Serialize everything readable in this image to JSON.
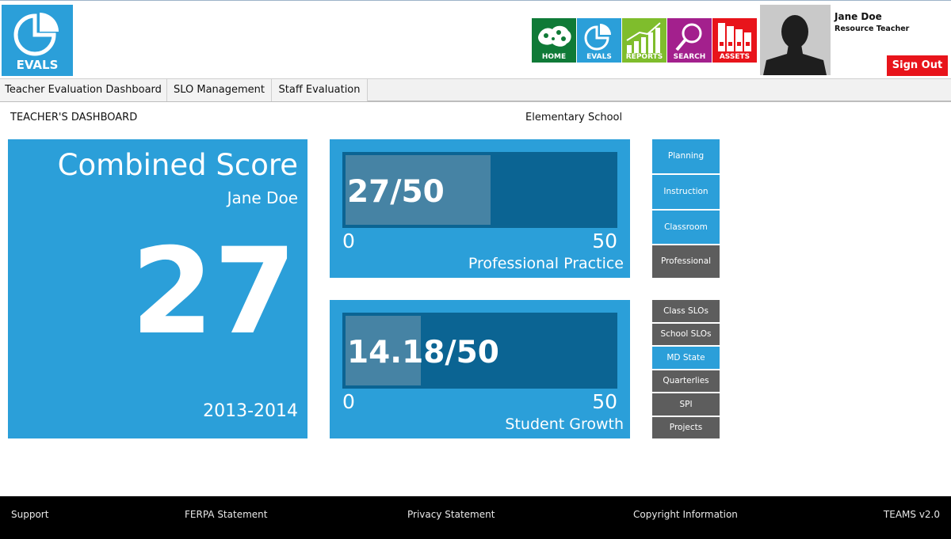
{
  "logo": {
    "text": "EVALS"
  },
  "nav": [
    {
      "label": "HOME",
      "color": "#0f7a37",
      "icon": "world-map-icon"
    },
    {
      "label": "EVALS",
      "color": "#2b9fd9",
      "icon": "pie-chart-icon"
    },
    {
      "label": "REPORTS",
      "color": "#7fbd2c",
      "icon": "bar-chart-icon"
    },
    {
      "label": "SEARCH",
      "color": "#a3208d",
      "icon": "magnifier-icon"
    },
    {
      "label": "ASSETS",
      "color": "#e8141b",
      "icon": "binders-icon"
    }
  ],
  "user": {
    "name": "Jane Doe",
    "role": "Resource Teacher",
    "signout": "Sign Out"
  },
  "tabs": [
    "Teacher Evaluation Dashboard",
    "SLO Management",
    "Staff Evaluation"
  ],
  "dashboard": {
    "title": "TEACHER'S DASHBOARD",
    "school": "Elementary School"
  },
  "combined": {
    "title": "Combined Score",
    "name": "Jane Doe",
    "score": "27",
    "year": "2013-2014"
  },
  "professional": {
    "value_text": "27/50",
    "value": 27,
    "max": 50,
    "min_label": "0",
    "max_label": "50",
    "label": "Professional Practice"
  },
  "growth": {
    "value_text": "14.18/50",
    "value": 14.18,
    "max": 50,
    "min_label": "0",
    "max_label": "50",
    "label": "Student Growth"
  },
  "side_top": [
    {
      "label": "Planning",
      "state": "active"
    },
    {
      "label": "Instruction",
      "state": "active"
    },
    {
      "label": "Classroom",
      "state": "active"
    },
    {
      "label": "Professional",
      "state": "inactive"
    }
  ],
  "side_bottom": [
    {
      "label": "Class SLOs",
      "state": "inactive"
    },
    {
      "label": "School SLOs",
      "state": "inactive"
    },
    {
      "label": "MD State",
      "state": "active"
    },
    {
      "label": "Quarterlies",
      "state": "inactive"
    },
    {
      "label": "SPI",
      "state": "inactive"
    },
    {
      "label": "Projects",
      "state": "inactive"
    }
  ],
  "footer": {
    "support": "Support",
    "ferpa": "FERPA Statement",
    "privacy": "Privacy Statement",
    "copyright": "Copyright Information",
    "version": "TEAMS v2.0"
  }
}
